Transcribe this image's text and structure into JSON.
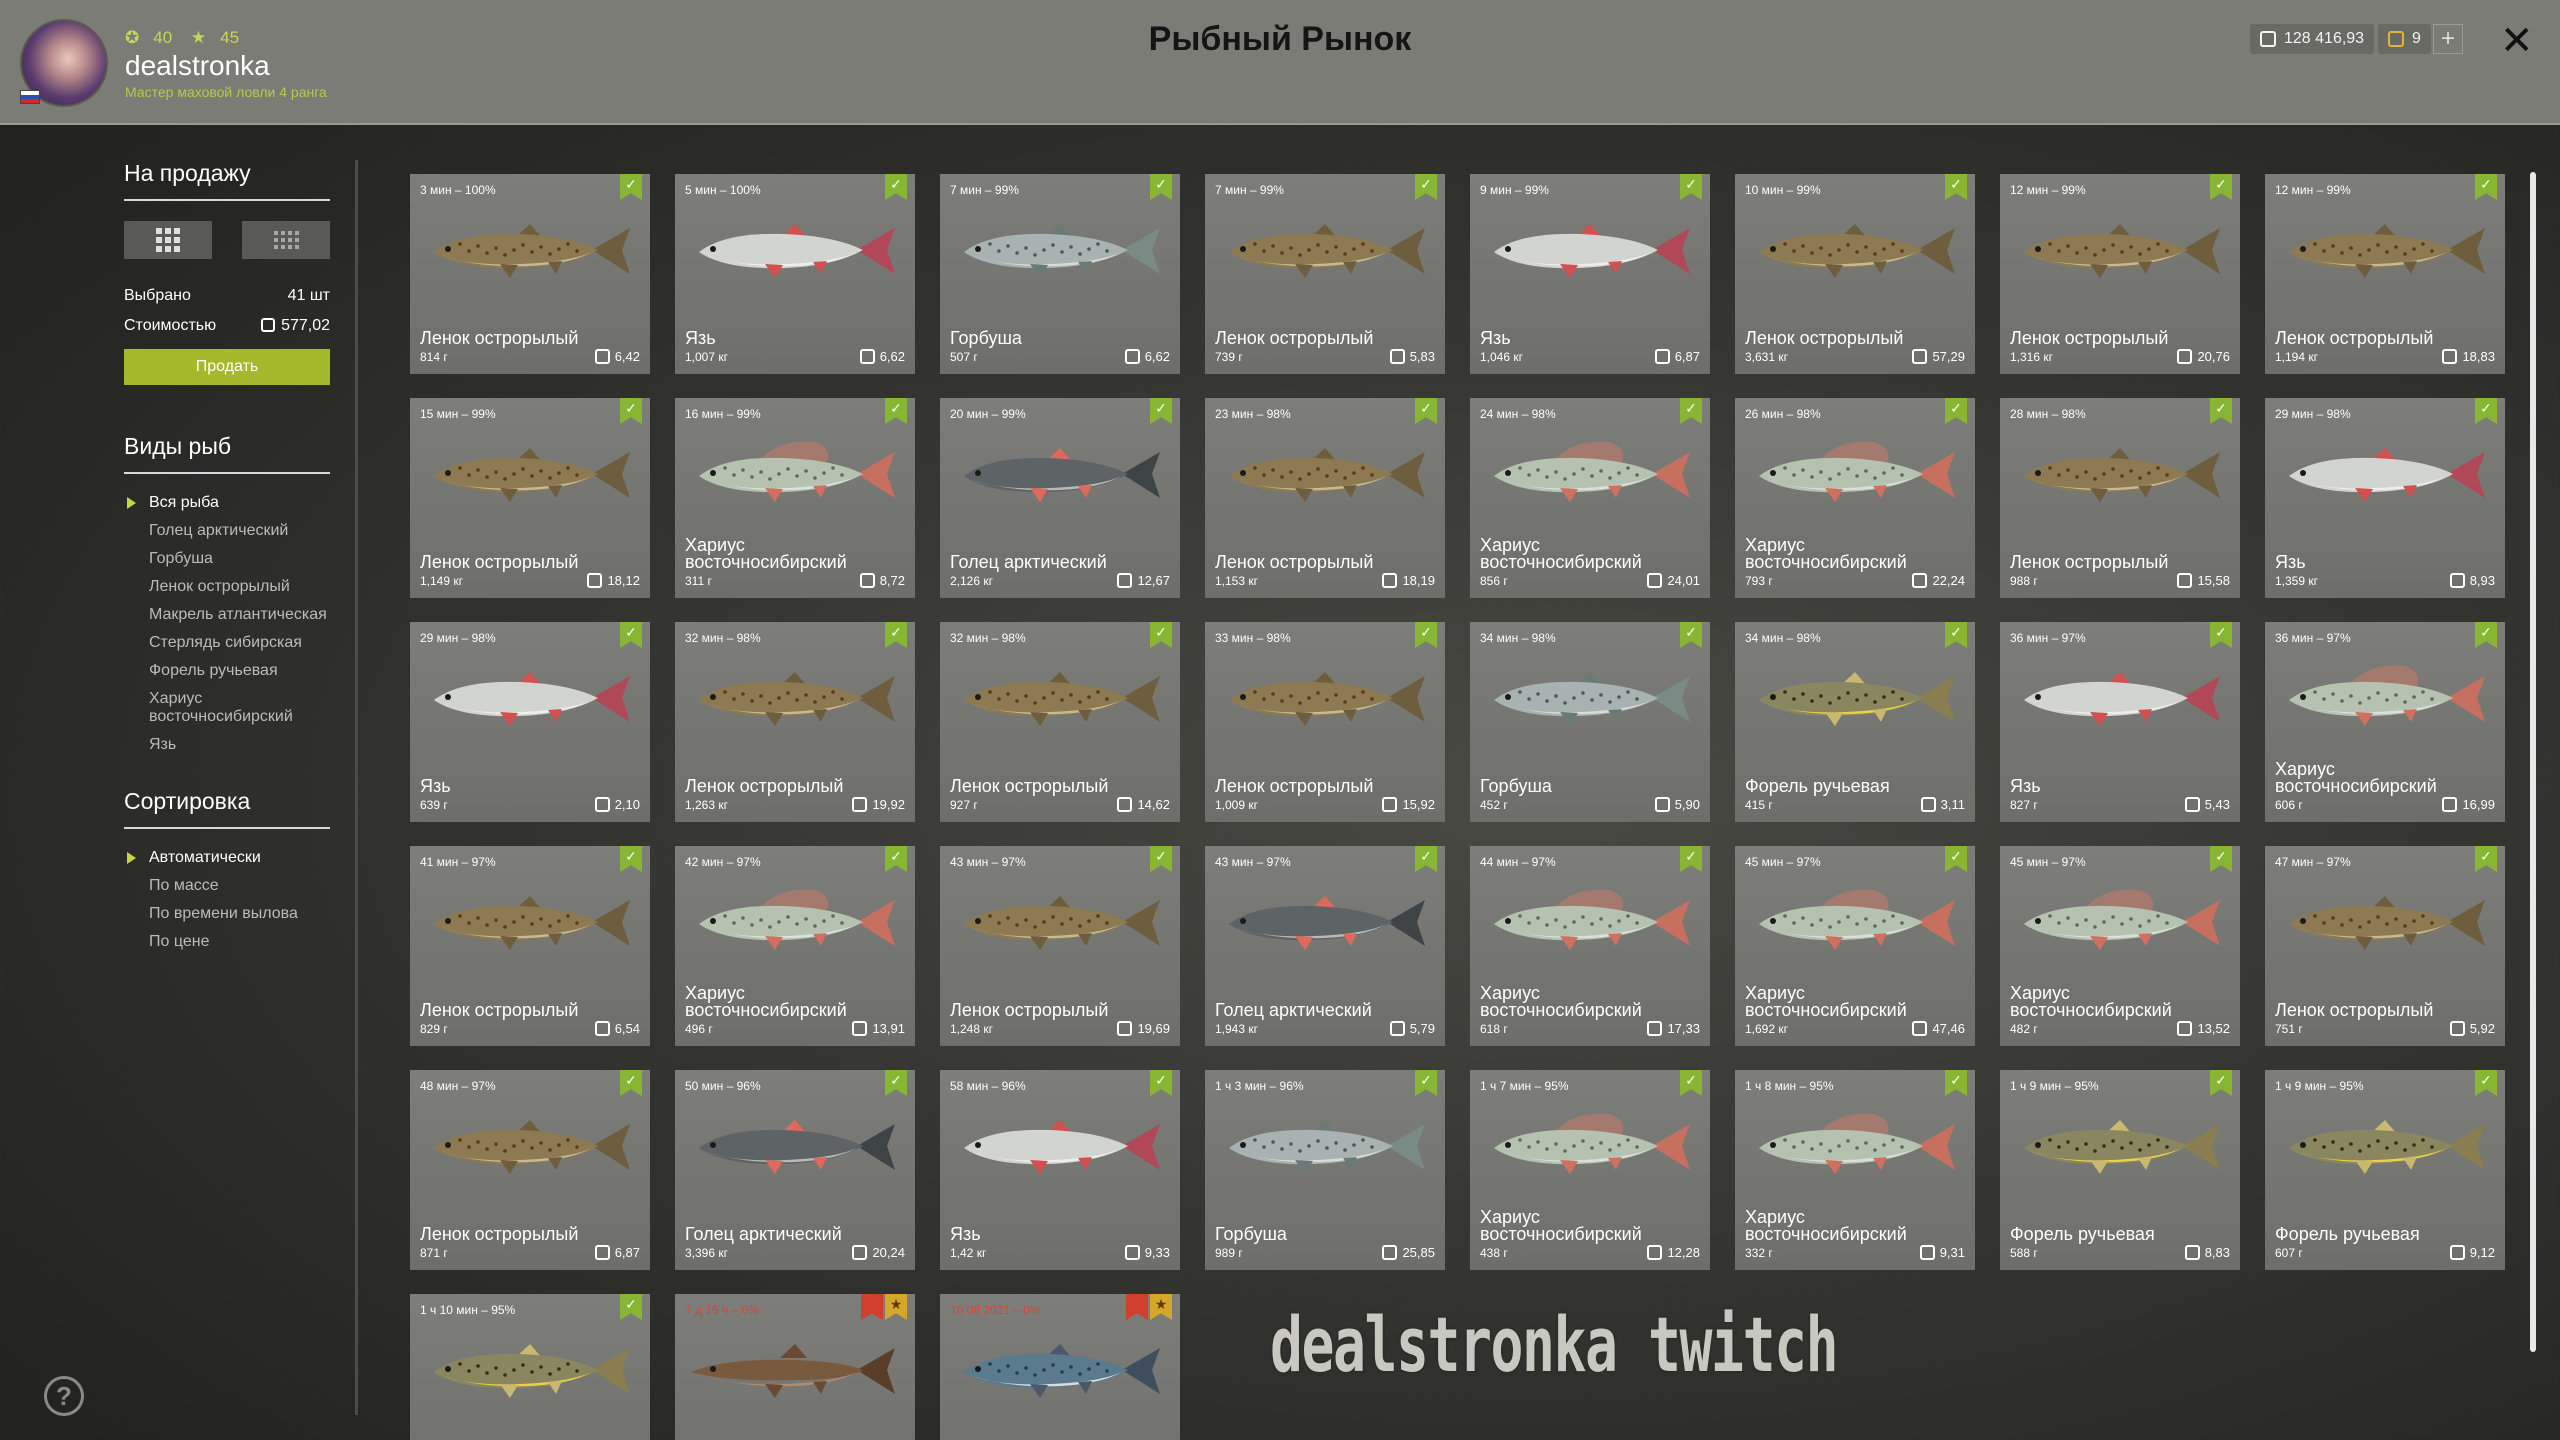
{
  "header": {
    "level": "40",
    "stars": "45",
    "username": "dealstronka",
    "rank": "Мастер маховой ловли 4 ранга",
    "title": "Рыбный Рынок",
    "silver": "128 416,93",
    "gold": "9",
    "plus": "+",
    "close": "✕"
  },
  "sidebar": {
    "sale_title": "На продажу",
    "selected_label": "Выбрано",
    "selected_value": "41 шт",
    "cost_label": "Стоимостью",
    "cost_value": "577,02",
    "sell_button": "Продать",
    "species_title": "Виды рыб",
    "species": [
      "Вся рыба",
      "Голец арктический",
      "Горбуша",
      "Ленок острорылый",
      "Макрель атлантическая",
      "Стерлядь сибирская",
      "Форель ручьевая",
      "Хариус восточносибирский",
      "Язь"
    ],
    "sort_title": "Сортировка",
    "sort": [
      "Автоматически",
      "По массе",
      "По времени вылова",
      "По цене"
    ]
  },
  "cards": [
    {
      "time": "3 мин – 100%",
      "name": "Ленок острорылый",
      "weight": "814 г",
      "price": "6,42",
      "fish": "lenok"
    },
    {
      "time": "5 мин – 100%",
      "name": "Язь",
      "weight": "1,007 кг",
      "price": "6,62",
      "fish": "yaz"
    },
    {
      "time": "7 мин – 99%",
      "name": "Горбуша",
      "weight": "507 г",
      "price": "6,62",
      "fish": "gorbusha"
    },
    {
      "time": "7 мин – 99%",
      "name": "Ленок острорылый",
      "weight": "739 г",
      "price": "5,83",
      "fish": "lenok"
    },
    {
      "time": "9 мин – 99%",
      "name": "Язь",
      "weight": "1,046 кг",
      "price": "6,87",
      "fish": "yaz"
    },
    {
      "time": "10 мин – 99%",
      "name": "Ленок острорылый",
      "weight": "3,631 кг",
      "price": "57,29",
      "fish": "lenok"
    },
    {
      "time": "12 мин – 99%",
      "name": "Ленок острорылый",
      "weight": "1,316 кг",
      "price": "20,76",
      "fish": "lenok"
    },
    {
      "time": "12 мин – 99%",
      "name": "Ленок острорылый",
      "weight": "1,194 кг",
      "price": "18,83",
      "fish": "lenok"
    },
    {
      "time": "15 мин – 99%",
      "name": "Ленок острорылый",
      "weight": "1,149 кг",
      "price": "18,12",
      "fish": "lenok"
    },
    {
      "time": "16 мин – 99%",
      "name": "Хариус восточносибирский",
      "weight": "311 г",
      "price": "8,72",
      "fish": "harius"
    },
    {
      "time": "20 мин – 99%",
      "name": "Голец арктический",
      "weight": "2,126 кг",
      "price": "12,67",
      "fish": "golets"
    },
    {
      "time": "23 мин – 98%",
      "name": "Ленок острорылый",
      "weight": "1,153 кг",
      "price": "18,19",
      "fish": "lenok"
    },
    {
      "time": "24 мин – 98%",
      "name": "Хариус восточносибирский",
      "weight": "856 г",
      "price": "24,01",
      "fish": "harius"
    },
    {
      "time": "26 мин – 98%",
      "name": "Хариус восточносибирский",
      "weight": "793 г",
      "price": "22,24",
      "fish": "harius"
    },
    {
      "time": "28 мин – 98%",
      "name": "Ленок острорылый",
      "weight": "988 г",
      "price": "15,58",
      "fish": "lenok"
    },
    {
      "time": "29 мин – 98%",
      "name": "Язь",
      "weight": "1,359 кг",
      "price": "8,93",
      "fish": "yaz"
    },
    {
      "time": "29 мин – 98%",
      "name": "Язь",
      "weight": "639 г",
      "price": "2,10",
      "fish": "yaz"
    },
    {
      "time": "32 мин – 98%",
      "name": "Ленок острорылый",
      "weight": "1,263 кг",
      "price": "19,92",
      "fish": "lenok"
    },
    {
      "time": "32 мин – 98%",
      "name": "Ленок острорылый",
      "weight": "927 г",
      "price": "14,62",
      "fish": "lenok"
    },
    {
      "time": "33 мин – 98%",
      "name": "Ленок острорылый",
      "weight": "1,009 кг",
      "price": "15,92",
      "fish": "lenok"
    },
    {
      "time": "34 мин – 98%",
      "name": "Горбуша",
      "weight": "452 г",
      "price": "5,90",
      "fish": "gorbusha"
    },
    {
      "time": "34 мин – 98%",
      "name": "Форель ручьевая",
      "weight": "415 г",
      "price": "3,11",
      "fish": "forel"
    },
    {
      "time": "36 мин – 97%",
      "name": "Язь",
      "weight": "827 г",
      "price": "5,43",
      "fish": "yaz"
    },
    {
      "time": "36 мин – 97%",
      "name": "Хариус восточносибирский",
      "weight": "606 г",
      "price": "16,99",
      "fish": "harius"
    },
    {
      "time": "41 мин – 97%",
      "name": "Ленок острорылый",
      "weight": "829 г",
      "price": "6,54",
      "fish": "lenok"
    },
    {
      "time": "42 мин – 97%",
      "name": "Хариус восточносибирский",
      "weight": "496 г",
      "price": "13,91",
      "fish": "harius"
    },
    {
      "time": "43 мин – 97%",
      "name": "Ленок острорылый",
      "weight": "1,248 кг",
      "price": "19,69",
      "fish": "lenok"
    },
    {
      "time": "43 мин – 97%",
      "name": "Голец арктический",
      "weight": "1,943 кг",
      "price": "5,79",
      "fish": "golets"
    },
    {
      "time": "44 мин – 97%",
      "name": "Хариус восточносибирский",
      "weight": "618 г",
      "price": "17,33",
      "fish": "harius"
    },
    {
      "time": "45 мин – 97%",
      "name": "Хариус восточносибирский",
      "weight": "1,692 кг",
      "price": "47,46",
      "fish": "harius"
    },
    {
      "time": "45 мин – 97%",
      "name": "Хариус восточносибирский",
      "weight": "482 г",
      "price": "13,52",
      "fish": "harius"
    },
    {
      "time": "47 мин – 97%",
      "name": "Ленок острорылый",
      "weight": "751 г",
      "price": "5,92",
      "fish": "lenok"
    },
    {
      "time": "48 мин – 97%",
      "name": "Ленок острорылый",
      "weight": "871 г",
      "price": "6,87",
      "fish": "lenok"
    },
    {
      "time": "50 мин – 96%",
      "name": "Голец арктический",
      "weight": "3,396 кг",
      "price": "20,24",
      "fish": "golets"
    },
    {
      "time": "58 мин – 96%",
      "name": "Язь",
      "weight": "1,42 кг",
      "price": "9,33",
      "fish": "yaz"
    },
    {
      "time": "1 ч 3 мин – 96%",
      "name": "Горбуша",
      "weight": "989 г",
      "price": "25,85",
      "fish": "gorbusha"
    },
    {
      "time": "1 ч 7 мин – 95%",
      "name": "Хариус восточносибирский",
      "weight": "438 г",
      "price": "12,28",
      "fish": "harius"
    },
    {
      "time": "1 ч 8 мин – 95%",
      "name": "Хариус восточносибирский",
      "weight": "332 г",
      "price": "9,31",
      "fish": "harius"
    },
    {
      "time": "1 ч 9 мин – 95%",
      "name": "Форель ручьевая",
      "weight": "588 г",
      "price": "8,83",
      "fish": "forel"
    },
    {
      "time": "1 ч 9 мин – 95%",
      "name": "Форель ручьевая",
      "weight": "607 г",
      "price": "9,12",
      "fish": "forel"
    },
    {
      "time": "1 ч 10 мин – 95%",
      "name": "",
      "weight": "",
      "price": "",
      "fish": "forel"
    },
    {
      "time": "7 д 16 ч – 0%",
      "name": "",
      "weight": "",
      "price": "",
      "fish": "sterlyad",
      "special": true
    },
    {
      "time": "10 08 2021 – 0%",
      "name": "",
      "weight": "",
      "price": "",
      "fish": "makrel",
      "special": true
    }
  ],
  "watermark": "dealstronka twitch",
  "help": "?"
}
